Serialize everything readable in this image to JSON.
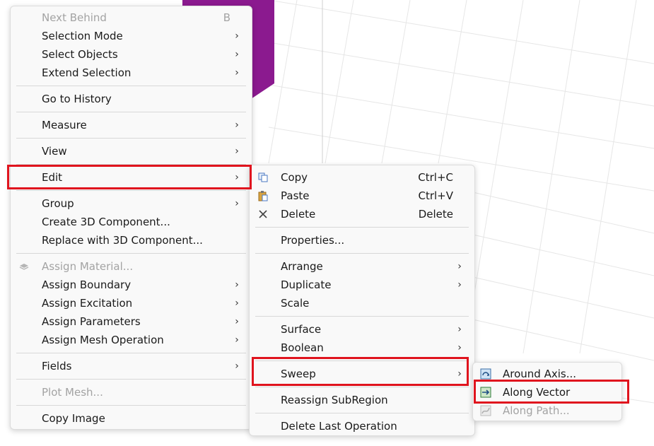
{
  "colors": {
    "menu_bg": "#f9f9f9",
    "highlight_border": "#e0141e",
    "disabled_text": "#a3a3a3",
    "shape_fill": "#8b1a8f"
  },
  "menu_main": {
    "next_behind": {
      "label": "Next Behind",
      "shortcut": "B"
    },
    "selection_mode": "Selection Mode",
    "select_objects": "Select Objects",
    "extend_selection": "Extend Selection",
    "go_to_history": "Go to History",
    "measure": "Measure",
    "view": "View",
    "edit": "Edit",
    "group": "Group",
    "create_3d": "Create 3D Component...",
    "replace_3d": "Replace with 3D Component...",
    "assign_material": "Assign Material...",
    "assign_boundary": "Assign Boundary",
    "assign_excitation": "Assign Excitation",
    "assign_parameters": "Assign Parameters",
    "assign_mesh": "Assign Mesh Operation",
    "fields": "Fields",
    "plot_mesh": "Plot Mesh...",
    "copy_image": "Copy Image"
  },
  "menu_edit": {
    "copy": {
      "label": "Copy",
      "shortcut": "Ctrl+C",
      "icon": "copy-icon"
    },
    "paste": {
      "label": "Paste",
      "shortcut": "Ctrl+V",
      "icon": "paste-icon"
    },
    "delete": {
      "label": "Delete",
      "shortcut": "Delete",
      "icon": "close-x-icon"
    },
    "properties": "Properties...",
    "arrange": "Arrange",
    "duplicate": "Duplicate",
    "scale": "Scale",
    "surface": "Surface",
    "boolean": "Boolean",
    "sweep": "Sweep",
    "reassign": "Reassign SubRegion",
    "delete_last": "Delete Last Operation"
  },
  "menu_sweep": {
    "around_axis": {
      "label": "Around Axis...",
      "icon": "sweep-around-axis-icon"
    },
    "along_vector": {
      "label": "Along Vector",
      "icon": "sweep-along-vector-icon"
    },
    "along_path": {
      "label": "Along Path...",
      "icon": "sweep-along-path-icon"
    }
  }
}
